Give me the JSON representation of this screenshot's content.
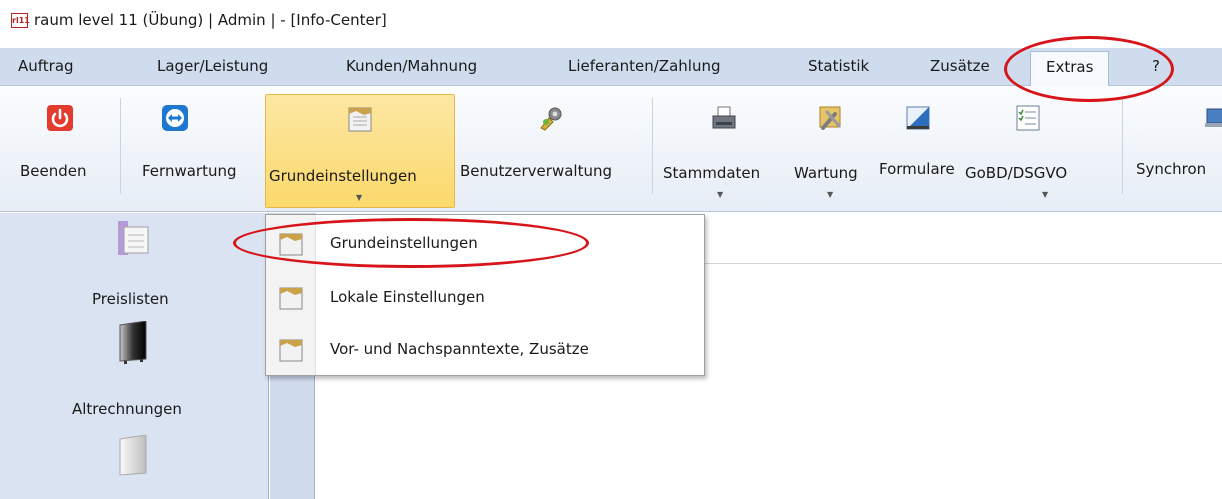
{
  "window": {
    "title": "raum level 11 (Übung) | Admin | - [Info-Center]",
    "icon_text": "rl11"
  },
  "menubar": {
    "items": [
      "Auftrag",
      "Lager/Leistung",
      "Kunden/Mahnung",
      "Lieferanten/Zahlung",
      "Statistik",
      "Zusätze",
      "Extras",
      "?"
    ],
    "active": "Extras"
  },
  "ribbon": {
    "buttons": [
      {
        "label": "Beenden",
        "icon": "power-icon"
      },
      {
        "label": "Fernwartung",
        "icon": "teamviewer-icon"
      },
      {
        "label": "Grundeinstellungen",
        "icon": "settings-sheet-icon",
        "dropdown": true,
        "highlighted": true
      },
      {
        "label": "Benutzerverwaltung",
        "icon": "users-gear-icon"
      },
      {
        "label": "Stammdaten",
        "icon": "printer-icon",
        "dropdown": true
      },
      {
        "label": "Wartung",
        "icon": "tools-icon",
        "dropdown": true
      },
      {
        "label": "Formulare",
        "icon": "form-ruler-icon"
      },
      {
        "label": "GoBD/DSGVO",
        "icon": "checklist-icon",
        "dropdown": true
      },
      {
        "label": "Synchron",
        "icon": "laptop-icon"
      }
    ]
  },
  "left_panel": {
    "items": [
      "Preislisten",
      "Altrechnungen"
    ]
  },
  "dropdown": {
    "items": [
      "Grundeinstellungen",
      "Lokale Einstellungen",
      "Vor- und Nachspanntexte, Zusätze"
    ]
  },
  "colors": {
    "menubar_bg": "#cfdcee",
    "highlight": "#fbd96b",
    "annotation": "#d8141b"
  }
}
